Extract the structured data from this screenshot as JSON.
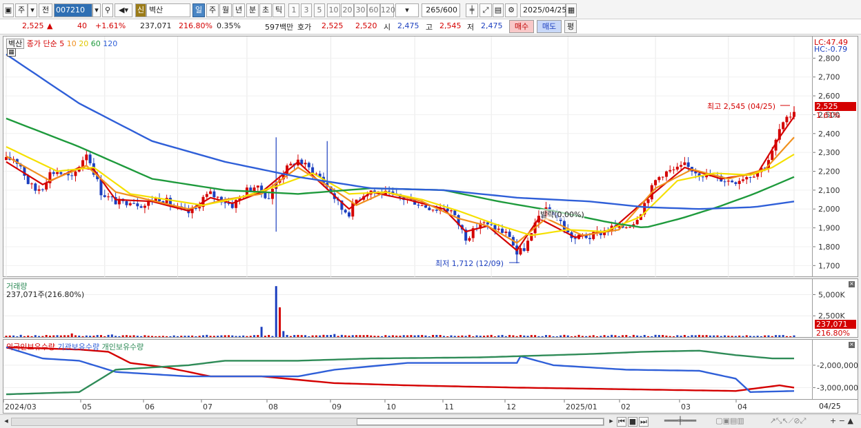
{
  "toolbar": {
    "period_tabs": [
      "주",
      "전"
    ],
    "code": "007210",
    "badge": "신",
    "name": "벽산",
    "intervals": [
      "일",
      "주",
      "월",
      "년",
      "분",
      "초",
      "틱"
    ],
    "active_interval": "일",
    "minutes": [
      "1",
      "3",
      "5",
      "10",
      "20",
      "30",
      "60",
      "120"
    ],
    "count": "265/600",
    "date": "2025/04/25"
  },
  "quote": {
    "price": "2,525",
    "arrow": "▲",
    "change": "40",
    "change_pct": "+1.61%",
    "volume": "237,071",
    "volume_ratio": "216.80%",
    "turnover": "0.35%",
    "amount": "597백만",
    "hoga_label": "호가",
    "ask": "2,525",
    "bid": "2,520",
    "open_label": "시",
    "open": "2,475",
    "high_label": "고",
    "high": "2,545",
    "low_label": "저",
    "low": "2,475",
    "buy_label": "매수",
    "sell_label": "매도",
    "eval_label": "평"
  },
  "price_pane": {
    "stock_tag": "벽산",
    "ma_legend_prefix": "종가 단순",
    "ma_periods": [
      "5",
      "10",
      "20",
      "60",
      "120"
    ],
    "ma_colors": [
      "#d40000",
      "#f0901e",
      "#f5e000",
      "#1e9a3c",
      "#2f5fd8"
    ],
    "lc": "LC:47.49",
    "hc": "HC:-0.79",
    "max_note": "최고 2,545 (04/25)",
    "min_note": "최저 1,712 (12/09)",
    "cross_note": "발락(0.00%)",
    "current_price_tag": "2,525",
    "current_pct_tag": "1.61%"
  },
  "volume_pane": {
    "title": "거래량",
    "subtitle": "237,071주(216.80%)",
    "current_tag": "237,071",
    "current_pct": "216.80%"
  },
  "holdings_pane": {
    "legend": [
      "외국인보유수량",
      "기관보유수량",
      "개인보유수량"
    ],
    "colors": [
      "#d40000",
      "#2f5fd8",
      "#2e8b57"
    ]
  },
  "xaxis": {
    "labels": [
      "2024/03",
      "05",
      "06",
      "07",
      "08",
      "09",
      "10",
      "11",
      "12",
      "2025/01",
      "02",
      "03",
      "04"
    ],
    "right_label": "04/25"
  },
  "chart_data": [
    {
      "type": "candlestick",
      "x_range": [
        "2024/03",
        "2025/04/25"
      ],
      "ylim": [
        1650,
        2900
      ],
      "yticks": [
        1700,
        1800,
        1900,
        2000,
        2100,
        2200,
        2300,
        2400,
        2500,
        2600,
        2700,
        2800
      ],
      "ytick_labels": [
        "1,700",
        "1,800",
        "1,900",
        "2,000",
        "2,100",
        "2,200",
        "2,300",
        "2,400",
        "2,500",
        "2,600",
        "2,700",
        "2,800"
      ],
      "high": 2545,
      "low": 1712,
      "last": 2525,
      "month_ticks": [
        "2024/03",
        "05",
        "06",
        "07",
        "08",
        "09",
        "10",
        "11",
        "12",
        "2025/01",
        "02",
        "03",
        "04"
      ],
      "close_path": [
        [
          0,
          2260
        ],
        [
          2,
          2270
        ],
        [
          4,
          2230
        ],
        [
          6,
          2140
        ],
        [
          8,
          2100
        ],
        [
          10,
          2120
        ],
        [
          12,
          2190
        ],
        [
          14,
          2200
        ],
        [
          16,
          2180
        ],
        [
          18,
          2160
        ],
        [
          20,
          2230
        ],
        [
          22,
          2300
        ],
        [
          24,
          2200
        ],
        [
          26,
          2090
        ],
        [
          28,
          2060
        ],
        [
          30,
          2040
        ],
        [
          32,
          2030
        ],
        [
          34,
          2050
        ],
        [
          36,
          2030
        ],
        [
          38,
          2020
        ],
        [
          40,
          2050
        ],
        [
          42,
          2060
        ],
        [
          44,
          2040
        ],
        [
          46,
          2010
        ],
        [
          48,
          1990
        ],
        [
          50,
          1980
        ],
        [
          52,
          2000
        ],
        [
          54,
          2060
        ],
        [
          56,
          2080
        ],
        [
          58,
          2060
        ],
        [
          60,
          2040
        ],
        [
          62,
          2020
        ],
        [
          64,
          2060
        ],
        [
          66,
          2100
        ],
        [
          68,
          2120
        ],
        [
          70,
          2090
        ],
        [
          72,
          2060
        ],
        [
          74,
          2140
        ],
        [
          76,
          2200
        ],
        [
          78,
          2230
        ],
        [
          80,
          2260
        ],
        [
          82,
          2230
        ],
        [
          84,
          2200
        ],
        [
          86,
          2170
        ],
        [
          88,
          2120
        ],
        [
          90,
          2060
        ],
        [
          92,
          2000
        ],
        [
          94,
          1980
        ],
        [
          96,
          2050
        ],
        [
          98,
          2080
        ],
        [
          100,
          2100
        ],
        [
          102,
          2090
        ],
        [
          104,
          2080
        ],
        [
          106,
          2070
        ],
        [
          108,
          2060
        ],
        [
          110,
          2050
        ],
        [
          112,
          2040
        ],
        [
          114,
          2020
        ],
        [
          116,
          2010
        ],
        [
          118,
          2000
        ],
        [
          120,
          2010
        ],
        [
          122,
          1990
        ],
        [
          124,
          1920
        ],
        [
          126,
          1850
        ],
        [
          128,
          1880
        ],
        [
          130,
          1930
        ],
        [
          132,
          1910
        ],
        [
          134,
          1900
        ],
        [
          136,
          1880
        ],
        [
          138,
          1860
        ],
        [
          140,
          1760
        ],
        [
          142,
          1790
        ],
        [
          144,
          1860
        ],
        [
          146,
          1960
        ],
        [
          148,
          1990
        ],
        [
          150,
          1980
        ],
        [
          152,
          1930
        ],
        [
          154,
          1870
        ],
        [
          156,
          1840
        ],
        [
          158,
          1860
        ],
        [
          160,
          1850
        ],
        [
          162,
          1870
        ],
        [
          164,
          1880
        ],
        [
          166,
          1900
        ],
        [
          168,
          1900
        ],
        [
          170,
          1910
        ],
        [
          172,
          1930
        ],
        [
          174,
          1990
        ],
        [
          176,
          2070
        ],
        [
          178,
          2150
        ],
        [
          180,
          2190
        ],
        [
          182,
          2200
        ],
        [
          184,
          2210
        ],
        [
          186,
          2230
        ],
        [
          188,
          2210
        ],
        [
          190,
          2190
        ],
        [
          192,
          2180
        ],
        [
          194,
          2170
        ],
        [
          196,
          2160
        ],
        [
          198,
          2150
        ],
        [
          200,
          2150
        ],
        [
          202,
          2170
        ],
        [
          204,
          2180
        ],
        [
          206,
          2200
        ],
        [
          208,
          2230
        ],
        [
          210,
          2300
        ],
        [
          212,
          2420
        ],
        [
          214,
          2470
        ],
        [
          216,
          2525
        ]
      ],
      "ma_series": [
        {
          "name": "5",
          "values": [
            [
              0,
              2250
            ],
            [
              10,
              2130
            ],
            [
              20,
              2220
            ],
            [
              24,
              2210
            ],
            [
              30,
              2050
            ],
            [
              40,
              2040
            ],
            [
              50,
              1990
            ],
            [
              56,
              2060
            ],
            [
              62,
              2030
            ],
            [
              70,
              2090
            ],
            [
              80,
              2250
            ],
            [
              90,
              2070
            ],
            [
              94,
              2000
            ],
            [
              100,
              2090
            ],
            [
              110,
              2050
            ],
            [
              120,
              2000
            ],
            [
              126,
              1880
            ],
            [
              132,
              1910
            ],
            [
              140,
              1780
            ],
            [
              146,
              1950
            ],
            [
              156,
              1850
            ],
            [
              166,
              1890
            ],
            [
              176,
              2060
            ],
            [
              186,
              2220
            ],
            [
              196,
              2160
            ],
            [
              206,
              2190
            ],
            [
              212,
              2380
            ],
            [
              216,
              2490
            ]
          ]
        },
        {
          "name": "10",
          "values": [
            [
              0,
              2280
            ],
            [
              12,
              2150
            ],
            [
              22,
              2230
            ],
            [
              30,
              2090
            ],
            [
              40,
              2045
            ],
            [
              50,
              2000
            ],
            [
              60,
              2050
            ],
            [
              70,
              2080
            ],
            [
              80,
              2220
            ],
            [
              90,
              2100
            ],
            [
              96,
              2020
            ],
            [
              104,
              2090
            ],
            [
              114,
              2040
            ],
            [
              124,
              1950
            ],
            [
              132,
              1910
            ],
            [
              140,
              1820
            ],
            [
              148,
              1950
            ],
            [
              158,
              1860
            ],
            [
              168,
              1890
            ],
            [
              178,
              2110
            ],
            [
              188,
              2210
            ],
            [
              198,
              2160
            ],
            [
              208,
              2210
            ],
            [
              216,
              2380
            ]
          ]
        },
        {
          "name": "20",
          "values": [
            [
              0,
              2330
            ],
            [
              14,
              2200
            ],
            [
              24,
              2220
            ],
            [
              34,
              2080
            ],
            [
              44,
              2050
            ],
            [
              54,
              2020
            ],
            [
              64,
              2060
            ],
            [
              74,
              2120
            ],
            [
              84,
              2190
            ],
            [
              94,
              2080
            ],
            [
              104,
              2090
            ],
            [
              114,
              2050
            ],
            [
              124,
              1990
            ],
            [
              134,
              1920
            ],
            [
              144,
              1860
            ],
            [
              154,
              1890
            ],
            [
              164,
              1880
            ],
            [
              174,
              1960
            ],
            [
              184,
              2150
            ],
            [
              194,
              2190
            ],
            [
              204,
              2180
            ],
            [
              210,
              2220
            ],
            [
              216,
              2290
            ]
          ]
        },
        {
          "name": "60",
          "values": [
            [
              0,
              2480
            ],
            [
              20,
              2330
            ],
            [
              40,
              2160
            ],
            [
              60,
              2100
            ],
            [
              80,
              2080
            ],
            [
              100,
              2110
            ],
            [
              120,
              2100
            ],
            [
              135,
              2040
            ],
            [
              150,
              1990
            ],
            [
              165,
              1930
            ],
            [
              175,
              1900
            ],
            [
              185,
              1950
            ],
            [
              195,
              2010
            ],
            [
              205,
              2080
            ],
            [
              216,
              2170
            ]
          ]
        },
        {
          "name": "120",
          "values": [
            [
              0,
              2820
            ],
            [
              20,
              2560
            ],
            [
              40,
              2360
            ],
            [
              60,
              2250
            ],
            [
              80,
              2170
            ],
            [
              100,
              2110
            ],
            [
              120,
              2100
            ],
            [
              140,
              2060
            ],
            [
              160,
              2040
            ],
            [
              175,
              2010
            ],
            [
              190,
              2000
            ],
            [
              205,
              2010
            ],
            [
              216,
              2040
            ]
          ]
        }
      ]
    },
    {
      "type": "bar",
      "title": "거래량",
      "yticks": [
        2500000,
        5000000
      ],
      "ytick_labels": [
        "2,500K",
        "5,000K"
      ],
      "ylim": [
        0,
        6500000
      ],
      "last": 237071,
      "spikes": [
        [
          29,
          300000
        ],
        [
          70,
          1200000
        ],
        [
          74,
          6000000
        ],
        [
          75,
          3500000
        ],
        [
          76,
          700000
        ],
        [
          18,
          420000
        ],
        [
          90,
          350000
        ]
      ]
    },
    {
      "type": "line",
      "series": [
        {
          "name": "외국인보유수량",
          "values": [
            [
              0,
              -1200000
            ],
            [
              20,
              -1300000
            ],
            [
              28,
              -1400000
            ],
            [
              34,
              -1900000
            ],
            [
              44,
              -2100000
            ],
            [
              56,
              -2500000
            ],
            [
              70,
              -2500000
            ],
            [
              90,
              -2800000
            ],
            [
              110,
              -2900000
            ],
            [
              140,
              -3000000
            ],
            [
              180,
              -3100000
            ],
            [
              200,
              -3150000
            ],
            [
              212,
              -2900000
            ],
            [
              216,
              -3000000
            ]
          ]
        },
        {
          "name": "기관보유수량",
          "values": [
            [
              0,
              -1200000
            ],
            [
              10,
              -1700000
            ],
            [
              20,
              -1800000
            ],
            [
              30,
              -2300000
            ],
            [
              50,
              -2500000
            ],
            [
              80,
              -2500000
            ],
            [
              90,
              -2200000
            ],
            [
              110,
              -1900000
            ],
            [
              140,
              -1900000
            ],
            [
              141,
              -1600000
            ],
            [
              150,
              -2000000
            ],
            [
              170,
              -2200000
            ],
            [
              190,
              -2250000
            ],
            [
              200,
              -2600000
            ],
            [
              204,
              -3200000
            ],
            [
              216,
              -3150000
            ]
          ]
        },
        {
          "name": "개인보유수량",
          "values": [
            [
              0,
              -3300000
            ],
            [
              20,
              -3200000
            ],
            [
              30,
              -2200000
            ],
            [
              50,
              -2000000
            ],
            [
              60,
              -1800000
            ],
            [
              80,
              -1800000
            ],
            [
              100,
              -1700000
            ],
            [
              130,
              -1650000
            ],
            [
              160,
              -1500000
            ],
            [
              175,
              -1400000
            ],
            [
              190,
              -1350000
            ],
            [
              200,
              -1550000
            ],
            [
              210,
              -1700000
            ],
            [
              216,
              -1700000
            ]
          ]
        }
      ],
      "yticks": [
        -2000000,
        -3000000
      ],
      "ytick_labels": [
        "-2,000,000",
        "-3,000,000"
      ],
      "ylim": [
        -3450000,
        -1050000
      ]
    }
  ]
}
